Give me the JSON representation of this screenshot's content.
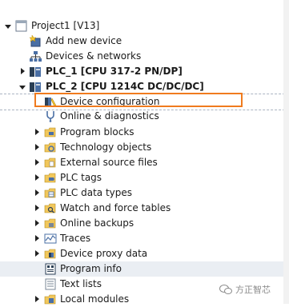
{
  "tree": {
    "project": "Project1 [V13]",
    "add_device": "Add new device",
    "devices_networks": "Devices & networks",
    "plc1": "PLC_1 [CPU 317-2 PN/DP]",
    "plc2": "PLC_2 [CPU 1214C DC/DC/DC]",
    "items": [
      "Device configuration",
      "Online & diagnostics",
      "Program blocks",
      "Technology objects",
      "External source files",
      "PLC tags",
      "PLC data types",
      "Watch and force tables",
      "Online backups",
      "Traces",
      "Device proxy data",
      "Program info",
      "Text lists",
      "Local modules"
    ]
  },
  "watermark": "方正智芯",
  "colors": {
    "highlight_box": "#f07b1e",
    "selected_row": "#eaeef3"
  }
}
